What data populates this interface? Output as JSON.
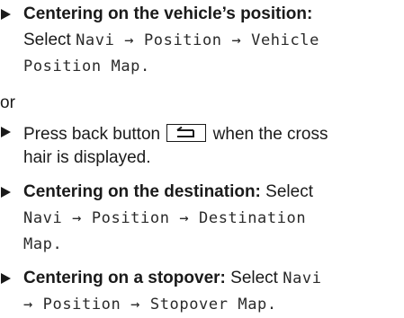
{
  "items": [
    {
      "title": "Centering on the vehicle’s position:",
      "select_word": "Select",
      "path": "Navi → Position → Vehicle",
      "path_cont": "Position Map."
    },
    {
      "or_text": "or"
    },
    {
      "text_before": "Press back button",
      "text_after": "when the cross",
      "text_cont": "hair is displayed.",
      "icon": "back-arrow-icon"
    },
    {
      "title": "Centering on the destination:",
      "select_word": "Select",
      "path": "Navi → Position → Destination",
      "path_cont": "Map."
    },
    {
      "title": "Centering on a stopover:",
      "select_word": "Select",
      "path_start": "Navi",
      "path_cont": "→ Position → Stopover Map."
    }
  ]
}
